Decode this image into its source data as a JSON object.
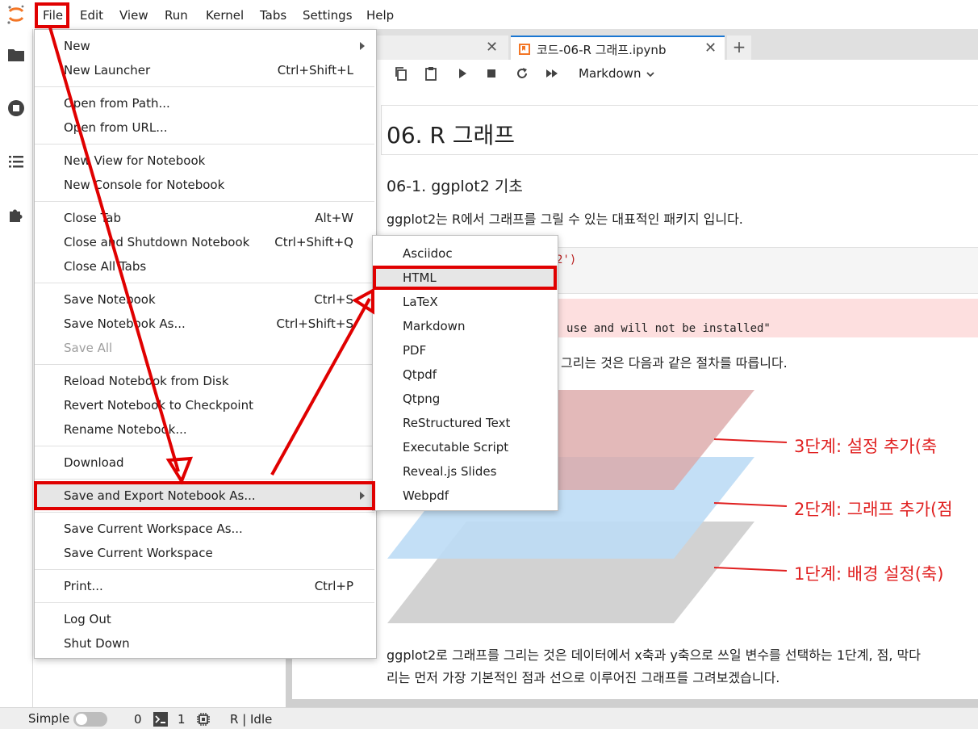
{
  "menubar": {
    "items": [
      "File",
      "Edit",
      "View",
      "Run",
      "Kernel",
      "Tabs",
      "Settings",
      "Help"
    ]
  },
  "tabs": {
    "active_label": "코드-06-R 그래프.ipynb",
    "new_tab": "+",
    "close": "✕"
  },
  "toolbar": {
    "cell_type": "Markdown"
  },
  "notebook": {
    "h1": "06. R 그래프",
    "h2": "06-1. ggplot2 기초",
    "intro": "ggplot2는 R에서 그래프를 그릴 수 있는 대표적인 패키지 입니다.",
    "code_fragment": "2')",
    "error_fragment": "use and will not be installed\"",
    "steps_text": "그리는 것은 다음과 같은 절차를 따릅니다.",
    "layer3": "3단계: 설정 추가(축",
    "layer2": "2단계: 그래프 추가(점",
    "layer1": "1단계: 배경 설정(축)",
    "para1": "ggplot2로 그래프를 그리는 것은 데이터에서 x축과 y축으로 쓰일 변수를 선택하는 1단계, 점, 막다",
    "para2": "리는 먼저 가장 기본적인 점과 선으로 이루어진 그래프를 그려보겠습니다."
  },
  "file_menu": {
    "groups": [
      [
        {
          "label": "New",
          "submenu": true
        },
        {
          "label": "New Launcher",
          "shortcut": "Ctrl+Shift+L"
        }
      ],
      [
        {
          "label": "Open from Path..."
        },
        {
          "label": "Open from URL..."
        }
      ],
      [
        {
          "label": "New View for Notebook"
        },
        {
          "label": "New Console for Notebook"
        }
      ],
      [
        {
          "label": "Close Tab",
          "shortcut": "Alt+W"
        },
        {
          "label": "Close and Shutdown Notebook",
          "shortcut": "Ctrl+Shift+Q"
        },
        {
          "label": "Close All Tabs"
        }
      ],
      [
        {
          "label": "Save Notebook",
          "shortcut": "Ctrl+S"
        },
        {
          "label": "Save Notebook As...",
          "shortcut": "Ctrl+Shift+S"
        },
        {
          "label": "Save All",
          "disabled": true
        }
      ],
      [
        {
          "label": "Reload Notebook from Disk"
        },
        {
          "label": "Revert Notebook to Checkpoint"
        },
        {
          "label": "Rename Notebook..."
        }
      ],
      [
        {
          "label": "Download"
        }
      ],
      [
        {
          "label": "Save and Export Notebook As...",
          "submenu": true,
          "highlighted": true
        }
      ],
      [
        {
          "label": "Save Current Workspace As..."
        },
        {
          "label": "Save Current Workspace"
        }
      ],
      [
        {
          "label": "Print...",
          "shortcut": "Ctrl+P"
        }
      ],
      [
        {
          "label": "Log Out"
        },
        {
          "label": "Shut Down"
        }
      ]
    ]
  },
  "export_menu": {
    "items": [
      "Asciidoc",
      "HTML",
      "LaTeX",
      "Markdown",
      "PDF",
      "Qtpdf",
      "Qtpng",
      "ReStructured Text",
      "Executable Script",
      "Reveal.js Slides",
      "Webpdf"
    ],
    "highlighted": "HTML"
  },
  "statusbar": {
    "mode_label": "Simple",
    "terminals": "0",
    "kernels": "1",
    "kernel_status": "R | Idle"
  },
  "colors": {
    "annotation_red": "#e00000",
    "accent": "#1976d2",
    "layer3": "#e3b6b6",
    "layer2": "#bcdcf5",
    "layer1": "#d2d2d2"
  }
}
